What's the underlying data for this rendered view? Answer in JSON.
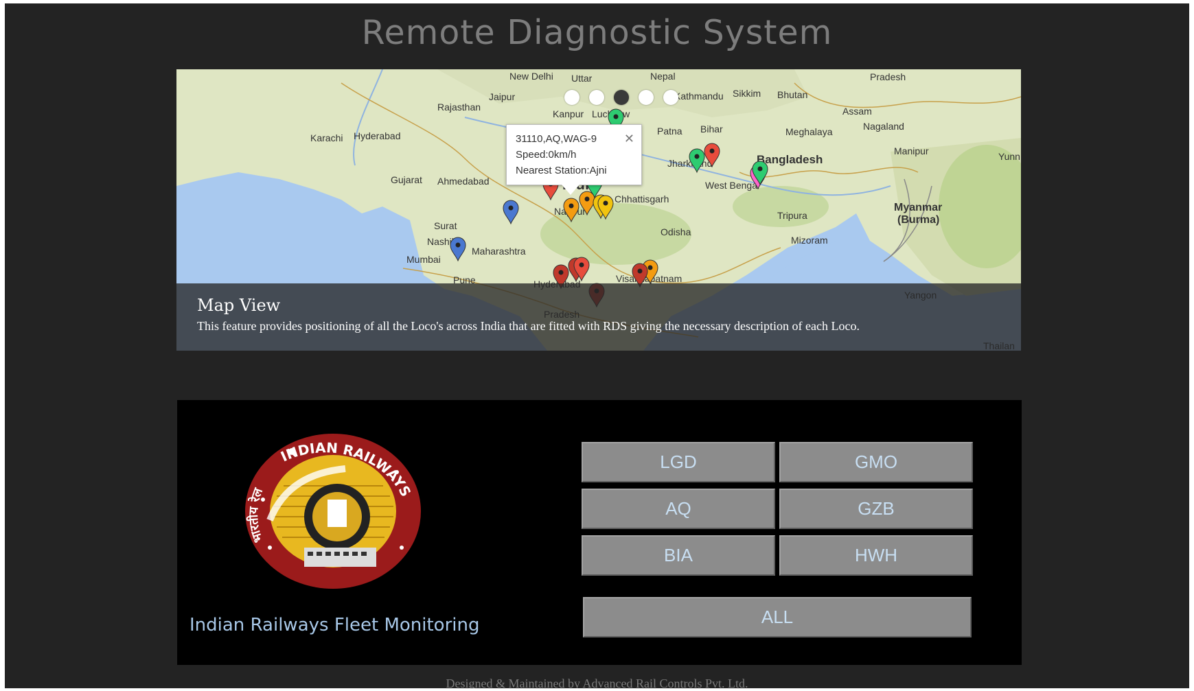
{
  "page": {
    "title": "Remote Diagnostic System"
  },
  "map": {
    "labels": [
      {
        "text": "New Delhi"
      },
      {
        "text": "Uttar"
      },
      {
        "text": "Nepal"
      },
      {
        "text": "Pradesh"
      },
      {
        "text": "Jaipur"
      },
      {
        "text": "Rajasthan"
      },
      {
        "text": "Kanpur"
      },
      {
        "text": "Lucknow"
      },
      {
        "text": "Kathmandu"
      },
      {
        "text": "Sikkim"
      },
      {
        "text": "Bhutan"
      },
      {
        "text": "Assam"
      },
      {
        "text": "Nagaland"
      },
      {
        "text": "Meghalaya"
      },
      {
        "text": "Manipur"
      },
      {
        "text": "Karachi"
      },
      {
        "text": "Hyderabad"
      },
      {
        "text": "Patna"
      },
      {
        "text": "Bihar"
      },
      {
        "text": "Jharkhand"
      },
      {
        "text": "Bangladesh"
      },
      {
        "text": "Gujarat"
      },
      {
        "text": "Ahmedabad"
      },
      {
        "text": "India"
      },
      {
        "text": "Chhattisgarh"
      },
      {
        "text": "West Bengal"
      },
      {
        "text": "Tripura"
      },
      {
        "text": "Myanmar"
      },
      {
        "text": "(Burma)"
      },
      {
        "text": "Surat"
      },
      {
        "text": "Odisha"
      },
      {
        "text": "Nashik"
      },
      {
        "text": "Maharashtra"
      },
      {
        "text": "Mizoram"
      },
      {
        "text": "Mumbai"
      },
      {
        "text": "Pune"
      },
      {
        "text": "Hyderabad"
      },
      {
        "text": "Visakhapatnam"
      },
      {
        "text": "Yangon"
      },
      {
        "text": "Pradesh"
      },
      {
        "text": "Nagpur"
      },
      {
        "text": "Yunn"
      },
      {
        "text": "Thailan"
      }
    ],
    "markers": [
      {
        "color": "#2ecc71"
      },
      {
        "color": "#2ecc71"
      },
      {
        "color": "#e74c3c"
      },
      {
        "color": "#2ecc71"
      },
      {
        "color": "#ff66cc"
      },
      {
        "color": "#2ecc71"
      },
      {
        "color": "#e74c3c"
      },
      {
        "color": "#f39c12"
      },
      {
        "color": "#f39c12"
      },
      {
        "color": "#f1c40f"
      },
      {
        "color": "#f1c40f"
      },
      {
        "color": "#4a78d0"
      },
      {
        "color": "#4a78d0"
      },
      {
        "color": "#c0392b"
      },
      {
        "color": "#c0392b"
      },
      {
        "color": "#e74c3c"
      },
      {
        "color": "#c0392b"
      },
      {
        "color": "#f39c12"
      },
      {
        "color": "#c0392b"
      }
    ],
    "carousel_active": 3,
    "info_window": {
      "line1": "31110,AQ,WAG-9",
      "line2": "Speed:0km/h",
      "line3": "Nearest Station:Ajni",
      "close_icon": "close-icon"
    },
    "caption": {
      "title": "Map View",
      "text": "This feature provides positioning of all the Loco's across India that are fitted with RDS giving the necessary description of each Loco."
    }
  },
  "panel": {
    "logo_text": "INDIAN RAILWAYS",
    "logo_hindi": "भारतीय रेल",
    "brand": "Indian Railways Fleet Monitoring",
    "buttons": {
      "lgd": "LGD",
      "gmo": "GMO",
      "aq": "AQ",
      "gzb": "GZB",
      "bia": "BIA",
      "hwh": "HWH",
      "all": "ALL"
    }
  },
  "footer": {
    "text": "Designed & Maintained by Advanced Rail Controls Pvt. Ltd."
  }
}
